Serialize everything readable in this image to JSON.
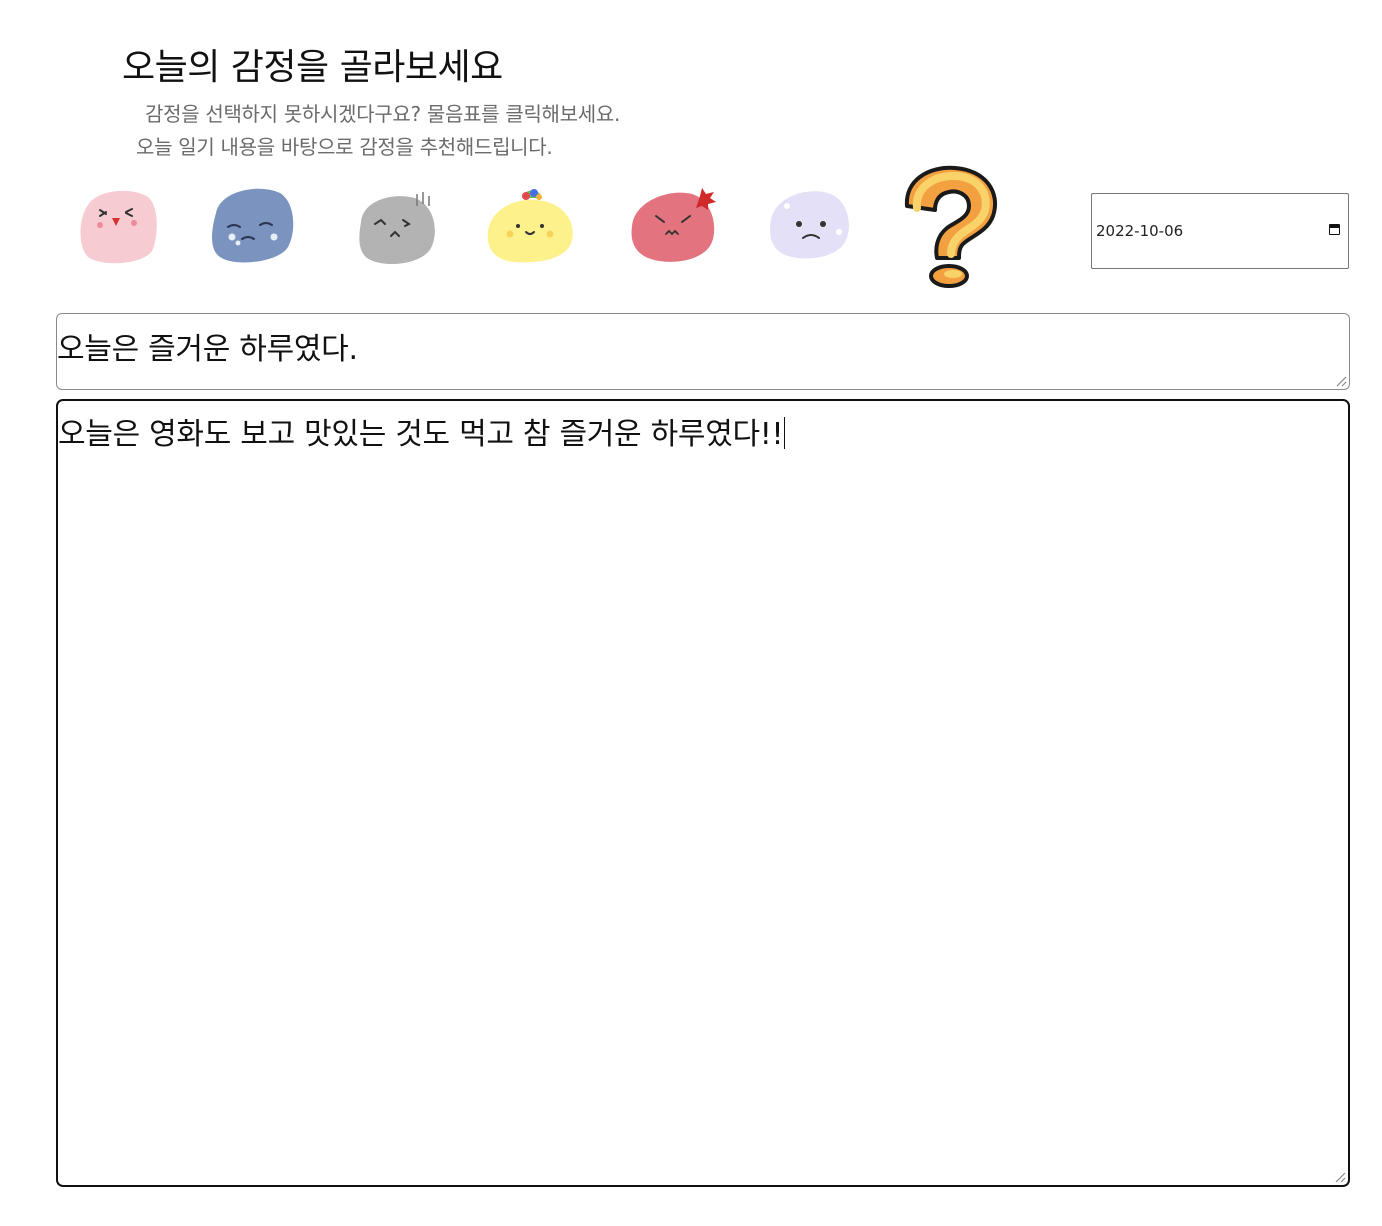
{
  "header": {
    "title": "오늘의 감정을 골라보세요",
    "subtitle_line1": "감정을 선택하지 못하시겠다구요? 물음표를 클릭해보세요.",
    "subtitle_line2": "오늘 일기 내용을 바탕으로 감정을 추천해드립니다."
  },
  "emotions": [
    {
      "icon": "happy-blob-icon",
      "color": "#f6cbd2"
    },
    {
      "icon": "sad-blob-icon",
      "color": "#7b93bf"
    },
    {
      "icon": "tired-blob-icon",
      "color": "#b3b3b3"
    },
    {
      "icon": "cheerful-blob-icon",
      "color": "#fdf18c"
    },
    {
      "icon": "angry-blob-icon",
      "color": "#e2737f"
    },
    {
      "icon": "worried-blob-icon",
      "color": "#e3e0f7"
    },
    {
      "icon": "question-mark-icon",
      "color": "#f2a040"
    }
  ],
  "date": {
    "value": "2022-10-06"
  },
  "diary": {
    "title_value": "오늘은 즐거운 하루였다.",
    "body_value": "오늘은 영화도 보고 맛있는 것도 먹고 참 즐거운 하루였다!!"
  }
}
